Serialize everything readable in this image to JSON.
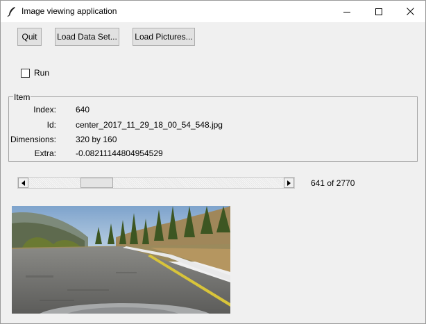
{
  "window": {
    "title": "Image viewing application",
    "icon": "feather-icon",
    "controls": [
      "minimize-icon",
      "maximize-icon",
      "close-icon"
    ]
  },
  "toolbar": {
    "quit_label": "Quit",
    "load_data_label": "Load Data Set...",
    "load_pictures_label": "Load Pictures..."
  },
  "run": {
    "label": "Run",
    "checked": false
  },
  "item": {
    "group_label": "Item",
    "fields": [
      {
        "label": "Index:",
        "value": "640"
      },
      {
        "label": "Id:",
        "value": "center_2017_11_29_18_00_54_548.jpg"
      },
      {
        "label": "Dimensions:",
        "value": "320 by 160"
      },
      {
        "label": "Extra:",
        "value": "-0.08211144804954529"
      }
    ]
  },
  "navigator": {
    "position_text": "641 of 2770",
    "position": 641,
    "total": 2770
  },
  "image": {
    "subject": "driving simulator road view",
    "colors": {
      "sky": "#8fb2d6",
      "road": "#6f6f6f",
      "grass": "#b59660",
      "trees": "#3f5a22",
      "lane_line": "#d8c43a"
    }
  }
}
